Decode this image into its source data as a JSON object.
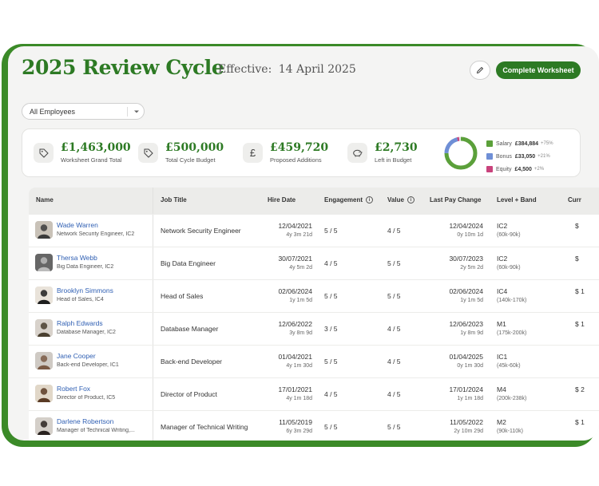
{
  "header": {
    "title": "2025 Review Cycle",
    "effective_label": "Effective:",
    "effective_date": "14 April 2025",
    "complete_label": "Complete Worksheet"
  },
  "filter": {
    "value": "All Employees"
  },
  "summary": {
    "stats": [
      {
        "icon": "tag-icon",
        "value": "£1,463,000",
        "label": "Worksheet Grand Total"
      },
      {
        "icon": "tag-icon",
        "value": "£500,000",
        "label": "Total Cycle Budget"
      },
      {
        "icon": "pound-icon",
        "value": "£459,720",
        "label": "Proposed Additions"
      },
      {
        "icon": "piggy-bank-icon",
        "value": "£2,730",
        "label": "Left in Budget"
      }
    ],
    "legend": [
      {
        "name": "Salary",
        "amount": "£384,884",
        "pct": "+75%",
        "color": "#5ba03a"
      },
      {
        "name": "Bonus",
        "amount": "£33,050",
        "pct": "+21%",
        "color": "#6f8fd6"
      },
      {
        "name": "Equity",
        "amount": "£4,500",
        "pct": "+2%",
        "color": "#c9437c"
      }
    ]
  },
  "table": {
    "columns": [
      "Name",
      "Job Title",
      "Hire Date",
      "Engagement",
      "Value",
      "Last Pay Change",
      "Level + Band",
      "Curr"
    ],
    "rows": [
      {
        "name": "Wade Warren",
        "sub": "Network Security Engineer, IC2",
        "job": "Network Security Engineer",
        "hire": "12/04/2021",
        "hire_ago": "4y 3m 21d",
        "eng": "5 / 5",
        "val": "4 / 5",
        "lpc": "12/04/2024",
        "lpc_ago": "0y 10m 1d",
        "level": "IC2",
        "band": "(60k-90k)",
        "cur": "$"
      },
      {
        "name": "Thersa Webb",
        "sub": "Big Data Engineer, IC2",
        "job": "Big Data Engineer",
        "hire": "30/07/2021",
        "hire_ago": "4y 5m 2d",
        "eng": "4 / 5",
        "val": "5 / 5",
        "lpc": "30/07/2023",
        "lpc_ago": "2y 5m 2d",
        "level": "IC2",
        "band": "(60k-90k)",
        "cur": "$"
      },
      {
        "name": "Brooklyn Simmons",
        "sub": "Head of Sales, IC4",
        "job": "Head of Sales",
        "hire": "02/06/2024",
        "hire_ago": "1y 1m 5d",
        "eng": "5 / 5",
        "val": "5 / 5",
        "lpc": "02/06/2024",
        "lpc_ago": "1y 1m 5d",
        "level": "IC4",
        "band": "(140k-170k)",
        "cur": "$ 1"
      },
      {
        "name": "Ralph Edwards",
        "sub": "Database Manager, IC2",
        "job": "Database Manager",
        "hire": "12/06/2022",
        "hire_ago": "3y 8m 9d",
        "eng": "3 / 5",
        "val": "4 / 5",
        "lpc": "12/06/2023",
        "lpc_ago": "1y 8m 9d",
        "level": "M1",
        "band": "(175k-200k)",
        "cur": "$ 1"
      },
      {
        "name": "Jane Cooper",
        "sub": "Back-end Developer, IC1",
        "job": "Back-end Developer",
        "hire": "01/04/2021",
        "hire_ago": "4y 1m 30d",
        "eng": "5 / 5",
        "val": "4 / 5",
        "lpc": "01/04/2025",
        "lpc_ago": "0y 1m 30d",
        "level": "IC1",
        "band": "(45k-60k)",
        "cur": ""
      },
      {
        "name": "Robert Fox",
        "sub": "Director of Product, IC5",
        "job": "Director of Product",
        "hire": "17/01/2021",
        "hire_ago": "4y 1m 18d",
        "eng": "4 / 5",
        "val": "4 / 5",
        "lpc": "17/01/2024",
        "lpc_ago": "1y 1m 18d",
        "level": "M4",
        "band": "(200k-238k)",
        "cur": "$ 2"
      },
      {
        "name": "Darlene Robertson",
        "sub": "Manager of Technical Writing,...",
        "job": "Manager of Technical Writing",
        "hire": "11/05/2019",
        "hire_ago": "6y 3m 29d",
        "eng": "5 / 5",
        "val": "5 / 5",
        "lpc": "11/05/2022",
        "lpc_ago": "2y 10m 29d",
        "level": "M2",
        "band": "(90k-110k)",
        "cur": "$ 1"
      }
    ]
  },
  "donut": {
    "salary": 0.75,
    "bonus": 0.21,
    "equity": 0.02
  }
}
